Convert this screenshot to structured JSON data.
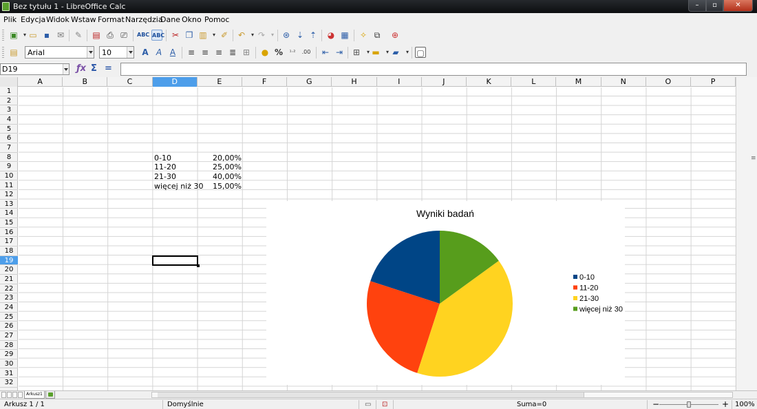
{
  "window": {
    "title": "Bez tytułu 1 - LibreOffice Calc"
  },
  "menu": [
    "Plik",
    "Edycja",
    "Widok",
    "Wstaw",
    "Format",
    "Narzędzia",
    "Dane",
    "Okno",
    "Pomoc"
  ],
  "formatting": {
    "font_name": "Arial",
    "font_size": "10"
  },
  "formula_bar": {
    "cell_ref": "D19",
    "value": ""
  },
  "columns": [
    "A",
    "B",
    "C",
    "D",
    "E",
    "F",
    "G",
    "H",
    "I",
    "J",
    "K",
    "L",
    "M",
    "N",
    "O",
    "P"
  ],
  "selected_column": "D",
  "rows": [
    "1",
    "2",
    "3",
    "4",
    "5",
    "6",
    "7",
    "8",
    "9",
    "10",
    "11",
    "12",
    "13",
    "14",
    "15",
    "16",
    "17",
    "18",
    "19",
    "20",
    "21",
    "22",
    "23",
    "24",
    "25",
    "26",
    "27",
    "28",
    "29",
    "30",
    "31",
    "32"
  ],
  "selected_row": "19",
  "cells": [
    {
      "label": "0-10",
      "value": "20,00%"
    },
    {
      "label": "11-20",
      "value": "25,00%"
    },
    {
      "label": "21-30",
      "value": "40,00%"
    },
    {
      "label": "więcej niż 30",
      "value": "15,00%"
    }
  ],
  "chart_data": {
    "type": "pie",
    "title": "Wyniki badań",
    "categories": [
      "0-10",
      "11-20",
      "21-30",
      "więcej niż 30"
    ],
    "values": [
      20,
      25,
      40,
      15
    ],
    "colors": [
      "#004586",
      "#ff420e",
      "#ffd320",
      "#579d1c"
    ],
    "legend": "right"
  },
  "sheet_tab": "Arkusz1",
  "status": {
    "sheet": "Arkusz 1 / 1",
    "style": "Domyślnie",
    "sum": "Suma=0",
    "zoom": "100%"
  }
}
